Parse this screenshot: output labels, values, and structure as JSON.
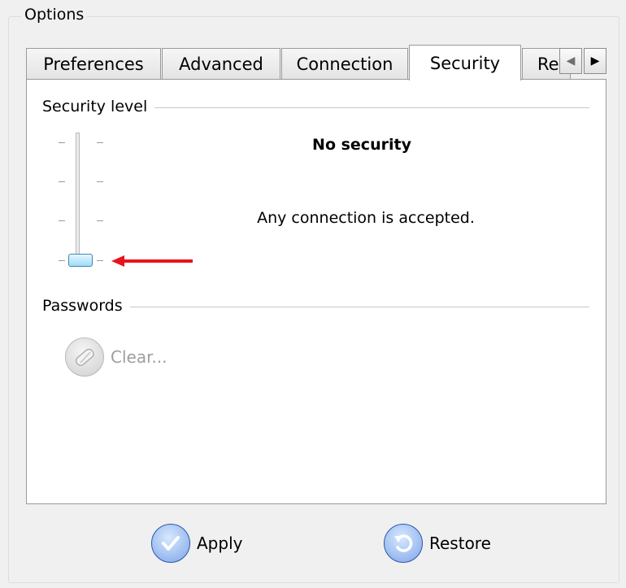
{
  "groupbox": {
    "title": "Options"
  },
  "tabs": [
    {
      "label": "Preferences",
      "active": false
    },
    {
      "label": "Advanced",
      "active": false
    },
    {
      "label": "Connection",
      "active": false
    },
    {
      "label": "Security",
      "active": true
    },
    {
      "label": "Re",
      "active": false,
      "truncated": true
    }
  ],
  "tab_scroll": {
    "left_icon": "triangle-left-icon",
    "right_icon": "triangle-right-icon"
  },
  "security": {
    "section_label": "Security level",
    "levels_count": 4,
    "selected_level_index": 0,
    "level_title": "No security",
    "level_description": "Any connection is accepted.",
    "annotation": {
      "icon": "red-arrow-icon",
      "color": "#e8141c"
    }
  },
  "passwords": {
    "section_label": "Passwords",
    "clear_button": {
      "label": "Clear...",
      "enabled": false,
      "icon": "eraser-icon"
    }
  },
  "footer": {
    "apply": {
      "label": "Apply",
      "icon": "checkmark-icon"
    },
    "restore": {
      "label": "Restore",
      "icon": "undo-icon"
    }
  },
  "colors": {
    "accent_blue": "#7ea4e8",
    "thumb_blue": "#9fdbf6",
    "arrow_red": "#e8141c"
  }
}
